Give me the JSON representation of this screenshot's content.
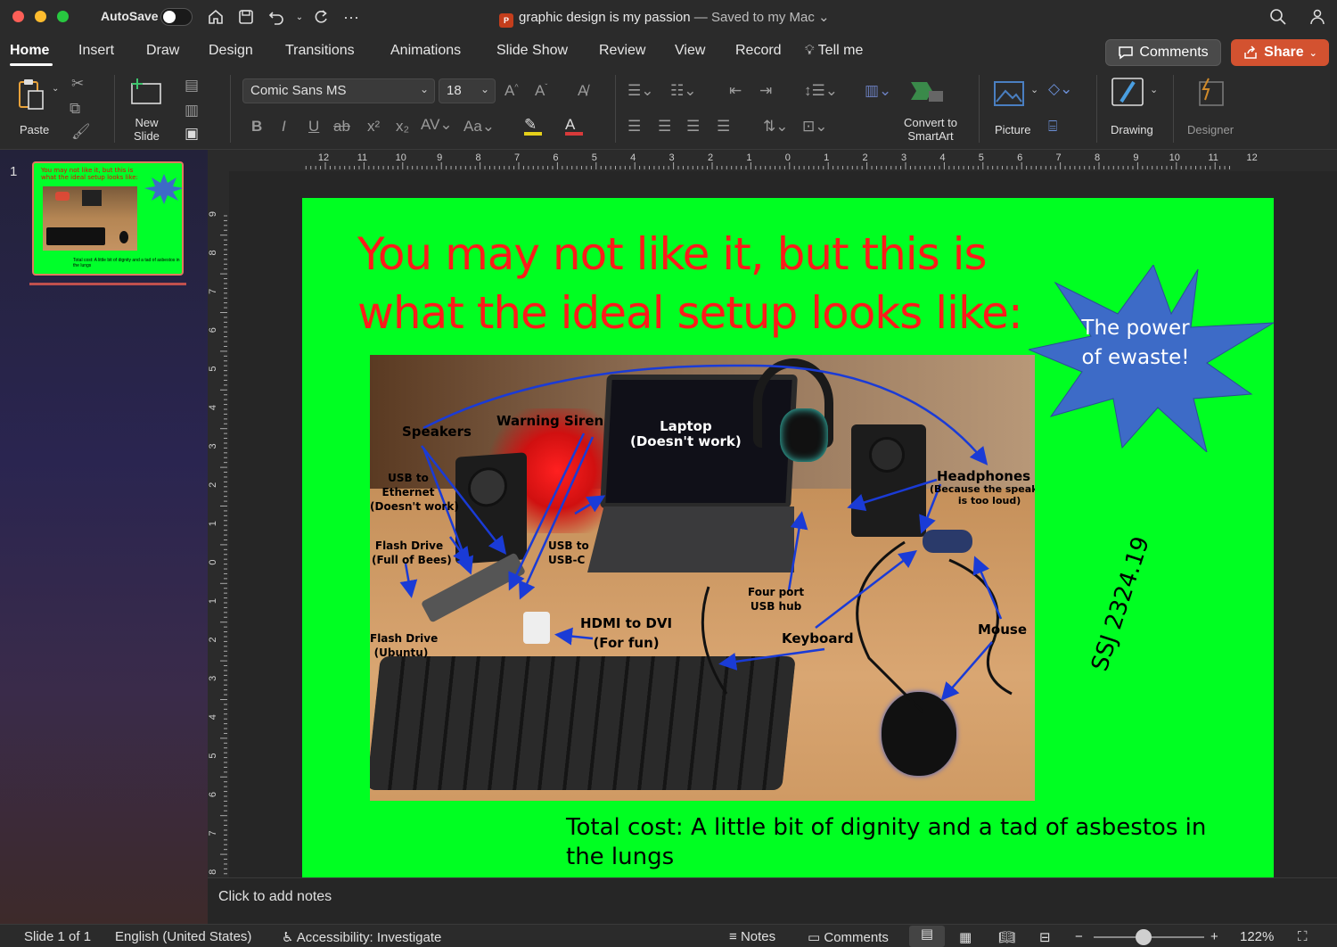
{
  "window": {
    "autosave_label": "AutoSave",
    "doc_title": "graphic design is my passion",
    "doc_status": " — Saved to my Mac"
  },
  "tabs": [
    {
      "label": "Home"
    },
    {
      "label": "Insert"
    },
    {
      "label": "Draw"
    },
    {
      "label": "Design"
    },
    {
      "label": "Transitions"
    },
    {
      "label": "Animations"
    },
    {
      "label": "Slide Show"
    },
    {
      "label": "Review"
    },
    {
      "label": "View"
    },
    {
      "label": "Record"
    },
    {
      "label": "Tell me"
    }
  ],
  "header_buttons": {
    "comments": "Comments",
    "share": "Share"
  },
  "ribbon": {
    "paste": "Paste",
    "new_slide": "New\nSlide",
    "font_name": "Comic Sans MS",
    "font_size": "18",
    "convert_smartart": "Convert to\nSmartArt",
    "picture": "Picture",
    "drawing": "Drawing",
    "designer": "Designer"
  },
  "thumbnail": {
    "number": "1",
    "title": "You may not like it, but this is what the ideal setup looks like:",
    "caption": "Total cost: A little bit of dignity and a tad of asbestos in the lungs"
  },
  "ruler": {
    "h_ticks": [
      "12",
      "11",
      "10",
      "9",
      "8",
      "7",
      "6",
      "5",
      "4",
      "3",
      "2",
      "1",
      "0",
      "1",
      "2",
      "3",
      "4",
      "5",
      "6",
      "7",
      "8",
      "9",
      "10",
      "11",
      "12"
    ],
    "v_ticks": [
      "9",
      "8",
      "7",
      "6",
      "5",
      "4",
      "3",
      "2",
      "1",
      "0",
      "1",
      "2",
      "3",
      "4",
      "5",
      "6",
      "7",
      "8"
    ]
  },
  "slide": {
    "title": "You may not like it, but this is what the ideal setup looks like:",
    "starburst_text": "The power of ewaste!",
    "rotated_text": "SSJ 2324.19",
    "total_cost": "Total cost: A little bit of dignity and a tad of asbestos in the lungs",
    "photo_labels": {
      "speakers": "Speakers",
      "warning_siren": "Warning Siren",
      "laptop": "Laptop\n(Doesn't work)",
      "usb_ethernet": "USB to\nEthernet\n(Doesn't work)",
      "flash_bees": "Flash Drive\n(Full of Bees)",
      "usb_c": "USB to\nUSB-C",
      "headphones": "Headphones",
      "headphones_note": "(Because the speaker\nis too loud)",
      "four_port": "Four port\nUSB hub",
      "hdmi_dvi": "HDMI to DVI\n(For fun)",
      "flash_ubuntu": "Flash Drive\n(Ubuntu)",
      "keyboard": "Keyboard",
      "mouse": "Mouse"
    }
  },
  "notes": {
    "placeholder": "Click to add notes"
  },
  "status": {
    "slide": "Slide 1 of 1",
    "language": "English (United States)",
    "accessibility": "Accessibility: Investigate",
    "notes_btn": "Notes",
    "comments_btn": "Comments",
    "zoom": "122%",
    "zoom_level_fraction": 0.45
  },
  "colors": {
    "slide_bg": "#00ff22",
    "title_red": "#ff1a1a",
    "starburst": "#3d6bc7",
    "share_orange": "#d35230",
    "arrow_blue": "#1a3bd6"
  }
}
